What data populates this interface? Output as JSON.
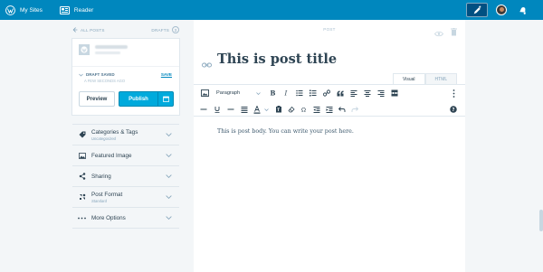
{
  "topbar": {
    "my_sites": "My Sites",
    "reader": "Reader"
  },
  "sidebar": {
    "all_posts": "ALL POSTS",
    "drafts": "DRAFTS",
    "drafts_count": "3",
    "draft_status": "DRAFT SAVED",
    "draft_time": "A FEW SECONDS AGO",
    "save": "SAVE",
    "preview": "Preview",
    "publish": "Publish",
    "accordion": [
      {
        "label": "Categories & Tags",
        "sub": "Uncategorized",
        "icon": "tag-icon"
      },
      {
        "label": "Featured Image",
        "sub": "",
        "icon": "image-icon"
      },
      {
        "label": "Sharing",
        "sub": "",
        "icon": "share-icon"
      },
      {
        "label": "Post Format",
        "sub": "Standard",
        "icon": "format-icon"
      },
      {
        "label": "More Options",
        "sub": "",
        "icon": "ellipsis-icon"
      }
    ]
  },
  "editor": {
    "post_label": "POST",
    "title": "This is post title",
    "tab_visual": "Visual",
    "tab_html": "HTML",
    "paragraph_select": "Paragraph",
    "body": "This is post body. You can write your post here."
  },
  "colors": {
    "topbar": "#0087be",
    "publish": "#00aadc",
    "background": "#f3f6f8"
  }
}
